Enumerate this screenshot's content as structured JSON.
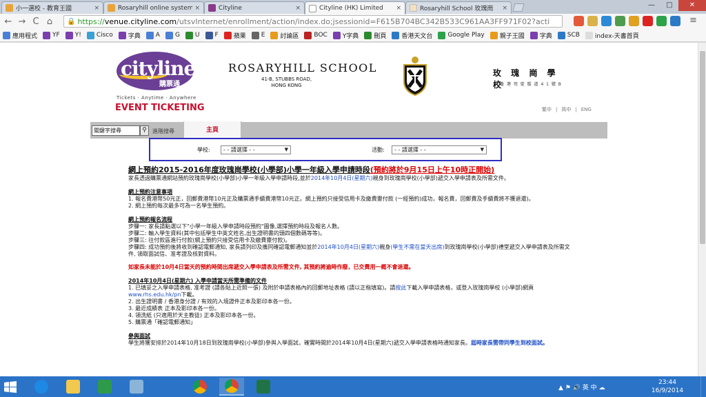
{
  "browser": {
    "tabs": [
      {
        "label": "小一選校 - 教育王國",
        "favicon_color": "#e8a33a",
        "active": false
      },
      {
        "label": "Rosaryhill online system",
        "favicon_color": "#e8a33a",
        "active": false
      },
      {
        "label": "Cityline",
        "favicon_color": "#8a3a8a",
        "active": false
      },
      {
        "label": "Cityline (HK) Limited",
        "favicon_color": "#ffffff",
        "active": true
      },
      {
        "label": "Rosaryhill School 玫瑰崗",
        "favicon_color": "#f3e0c0",
        "active": false
      }
    ],
    "tab_close": "×",
    "window_controls": {
      "minimize": "—",
      "maximize": "□",
      "close": "✕"
    },
    "nav": {
      "back": "←",
      "forward": "→",
      "reload": "C",
      "home": "⌂"
    },
    "url": {
      "scheme": "https://",
      "host": "venue.cityline.com",
      "path": "/utsvInternet/enrollment/action/index.do;jsessionid=F615B704BC342B533C961AA3FF971F02?acti"
    },
    "bookmarks": [
      {
        "label": "應用程式",
        "icon_color": "#4a7fd6"
      },
      {
        "label": "YF",
        "icon_color": "#7b3fb0"
      },
      {
        "label": "Y!",
        "icon_color": "#7b3fb0"
      },
      {
        "label": "Cisco",
        "icon_color": "#3aa0d6"
      },
      {
        "label": "字典",
        "icon_color": "#7b3fb0"
      },
      {
        "label": "A",
        "icon_color": "#4a7fd6"
      },
      {
        "label": "G",
        "icon_color": "#4a7fd6"
      },
      {
        "label": "U",
        "icon_color": "#2c8a2c"
      },
      {
        "label": "F",
        "icon_color": "#3b5998"
      },
      {
        "label": "蘋果",
        "icon_color": "#d22"
      },
      {
        "label": "E",
        "icon_color": "#666"
      },
      {
        "label": "討論區",
        "icon_color": "#e89a1a"
      },
      {
        "label": "BOC",
        "icon_color": "#b22"
      },
      {
        "label": "Y字典",
        "icon_color": "#7b3fb0"
      },
      {
        "label": "刪頁",
        "icon_color": "#2c8a2c"
      },
      {
        "label": "香港天文台",
        "icon_color": "#2c7ac6"
      },
      {
        "label": "Google Play",
        "icon_color": "#2ca24a"
      },
      {
        "label": "親子王國",
        "icon_color": "#e89a1a"
      },
      {
        "label": "字典",
        "icon_color": "#7b3fb0"
      },
      {
        "label": "SCB",
        "icon_color": "#2c7ac6"
      },
      {
        "label": "index-天書首頁",
        "icon_color": "#ddd"
      }
    ]
  },
  "site": {
    "logo_word": "cityline",
    "logo_sub": "購票通",
    "tagline": "Tickets · Anytime · Anywhere",
    "event_ticketing": "EVENT TICKETING",
    "school_name": "ROSARYHILL SCHOOL",
    "school_addr_line1": "41-B, STUBBS ROAD,",
    "school_addr_line2": "HONG KONG",
    "school_name_chi": "玫 瑰 崗 學 校",
    "school_addr_chi": "香 港 司 徒 拔 道 4 1 號 B",
    "lang": [
      "繁中",
      "简中",
      "ENG"
    ],
    "lang_sep": "|",
    "search_placeholder": "關鍵字搜尋",
    "search_glyph": "⚲",
    "adv_search": "進階搜尋",
    "home_tab": "主頁"
  },
  "filters": {
    "school_label": "學校:",
    "school_value": "- - 請選擇 - -",
    "event_label": "活動:",
    "event_value": "- - 請選擇 - -",
    "arrow": "▼"
  },
  "content": {
    "title_main": "網上預約2015-2016年度玫瑰崗學校(小學部)小學一年級入學申請時段",
    "title_hl": "(預約將於9月15日上午10時正開始)",
    "intro_a": "家長透過購票通網站預約玫瑰崗學校(小學部)小學一年級入學申請時段,並於",
    "intro_date": "2014年10月4日(星期六)",
    "intro_b": "親身到玫瑰崗學校(小學部)遞交入學申請表及所需文件。",
    "s1_title": "網上預約注意事項",
    "s1_items": [
      "1. 報名費港幣50元正，回郵費港幣10元正及購票通手續費港幣10元正。網上預約只接受信用卡及繳費靈付款 (一經預約)成功，報名費，回郵費及手續費將不獲退還)。",
      "2. 網上預約每次最多可為一名學生預約。"
    ],
    "s2_title": "網上預約報名流程",
    "s2_items": [
      "步驟一: 家長請點選以下\"小學一年級入學申請時段預約\"圖像,選擇預約時段及報名人數。",
      "步驟二: 輸入學生資料(其中包括學生中英文姓名,出生證明書的頭四個數碼等等)。",
      "步驟三: 往付款區進行付款(網上預約只接受信用卡及繳費靈付款)。"
    ],
    "s2_step4_a": "步驟四: 成功預約後將收到確認電郵通知, 家長請列印及攜同確認電郵通知並於",
    "s2_step4_date": "2014年10月4日(星期六)",
    "s2_step4_b": "親身",
    "s2_step4_red": "(學生不需在當天出席)",
    "s2_step4_c": "到玫瑰崗學校(小學部)禮堂遞交入學申請表及所需文件, 領取面試信、准考證及核對資料。",
    "warning": "如家長未能於10月4日當天的預約時間出席遞交入學申請表及所需文件, 其預約將逾時作廢，已交費用一概不會退還。",
    "s3_title": "2014年10月4日(星期六) 入學申請當天所需準備的文件",
    "s3_item1": "1. 已填妥之入學申請表格, 准考證 (請各貼上近照一張) 及附於申請表格內的回郵地址表格 (請以正楷填寫)。請",
    "s3_item1_link": "按此",
    "s3_item1_b": "下載入學申請表格，或登入玫瑰崗學校 (小學部)網頁",
    "s3_site": "www.rhs.edu.hk/pn",
    "s3_item1_c": "下載。",
    "s3_items": [
      "2. 出生證明書 / 香港身分證 / 有效的入境證件正本及影印本各一份。",
      "3. 最近成績表 正本及影印本各一份。",
      "4. 領洗紙 (只適用於天主教徒) 正本及影印本各一份。",
      "5. 購票通「確認電郵通知」"
    ],
    "s4_title": "參與面試",
    "s4_text": "學生將獲安排於2014年10月18日到玫瑰崗學校(小學部)參與入學面試，確實時間於2014年10月4日(星期六)遞交入學申請表格時通知家長。",
    "s4_blue": "屆時家長需帶同學生到校面試。"
  },
  "taskbar": {
    "tray_text": "▲ ⚑ 🔊 英 中 ☁",
    "time": "23:44",
    "date": "16/9/2014",
    "apps": [
      "ie",
      "explorer",
      "store",
      "photos",
      "chrome",
      "chrome-active",
      "excel"
    ]
  }
}
